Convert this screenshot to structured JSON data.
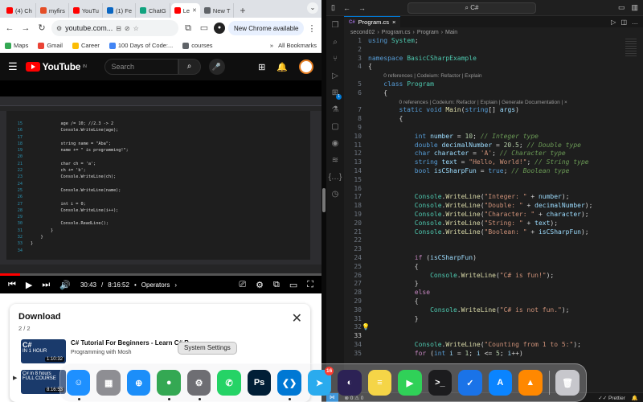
{
  "chrome": {
    "tabs": [
      {
        "label": "(4) Ch",
        "color": "#ff0000"
      },
      {
        "label": "myfirs",
        "color": "#e44d26"
      },
      {
        "label": "YouTu",
        "color": "#ff0000"
      },
      {
        "label": "(1) Fe",
        "color": "#0a66c2"
      },
      {
        "label": "ChatG",
        "color": "#10a37f"
      },
      {
        "label": "Le",
        "color": "#ff0000"
      },
      {
        "label": "New T",
        "color": "#5f6368"
      }
    ],
    "newtab_plus": "+",
    "url": "youtube.com...",
    "new_chrome_label": "New Chrome available",
    "profile_initial": "",
    "bookmarks": [
      {
        "label": "Maps",
        "color": "#34a853"
      },
      {
        "label": "Gmail",
        "color": "#ea4335"
      },
      {
        "label": "Career",
        "color": "#fbbc04"
      },
      {
        "label": "100 Days of Code:...",
        "color": "#4285f4"
      },
      {
        "label": "courses",
        "color": "#5f6368"
      }
    ],
    "all_bookmarks": "All Bookmarks",
    "more_bookmarks": "»"
  },
  "youtube": {
    "logo_text": "YouTube",
    "logo_region": "IN",
    "search_placeholder": "Search",
    "player": {
      "current_time": "30:43",
      "duration": "8:16:52",
      "time_separator": "/",
      "chapter": "Operators",
      "chapter_arrow": "›",
      "progress_fraction": 0.062
    },
    "vs_code_lines": [
      {
        "n": "15",
        "t": "            age /= 10; //2.3 -> 2"
      },
      {
        "n": "16",
        "t": "            Console.WriteLine(age);"
      },
      {
        "n": "17",
        "t": ""
      },
      {
        "n": "18",
        "t": "            string name = \"Aba\";"
      },
      {
        "n": "19",
        "t": "            name += \" is programming!\";"
      },
      {
        "n": "20",
        "t": ""
      },
      {
        "n": "21",
        "t": "            char ch = 'a';"
      },
      {
        "n": "22",
        "t": "            ch += 'b';"
      },
      {
        "n": "23",
        "t": "            Console.WriteLine(ch);"
      },
      {
        "n": "24",
        "t": ""
      },
      {
        "n": "25",
        "t": "            Console.WriteLine(name);"
      },
      {
        "n": "26",
        "t": ""
      },
      {
        "n": "27",
        "t": "            int i = 0;"
      },
      {
        "n": "28",
        "t": "            Console.WriteLine(i++);"
      },
      {
        "n": "29",
        "t": ""
      },
      {
        "n": "30",
        "t": "            Console.ReadLine();"
      },
      {
        "n": "31",
        "t": "        }"
      },
      {
        "n": "32",
        "t": "    }"
      },
      {
        "n": "33",
        "t": "}"
      },
      {
        "n": "34",
        "t": ""
      }
    ]
  },
  "download": {
    "title": "Download",
    "count": "2 / 2",
    "items": [
      {
        "title": "C# Tutorial For Beginners - Learn C# B",
        "channel": "Programming with Mosh",
        "duration": "1:10:32",
        "thumb_title": "C#",
        "thumb_sub": "IN 1 HOUR"
      },
      {
        "title": "",
        "channel": "",
        "duration": "8:16:53",
        "thumb_title": "C# in 8 hours",
        "thumb_sub": "FULL COURSE"
      }
    ]
  },
  "vscode": {
    "search_text": "C#",
    "tab_label": "Program.cs",
    "breadcrumb": [
      "second02",
      "Program.cs",
      "Program",
      "Main"
    ],
    "lines": [
      {
        "n": "1",
        "h": "<span class='kw'>using</span> <span class='ty'>System</span>;"
      },
      {
        "n": "2",
        "h": ""
      },
      {
        "n": "3",
        "h": "<span class='kw'>namespace</span> <span class='ty'>BasicCSharpExample</span>"
      },
      {
        "n": "4",
        "h": "{"
      },
      {
        "n": "",
        "h": "    <span class='lens'>0 references | Codeium: Refactor | Explain</span>"
      },
      {
        "n": "5",
        "h": "    <span class='kw'>class</span> <span class='ty'>Program</span>"
      },
      {
        "n": "6",
        "h": "    {"
      },
      {
        "n": "",
        "h": "        <span class='lens'>0 references | Codeium: Refactor | Explain | Generate Documentation | ×</span>"
      },
      {
        "n": "7",
        "h": "        <span class='kw'>static</span> <span class='kw'>void</span> <span class='fn'>Main</span>(<span class='kw'>string</span>[] <span class='vr'>args</span>)"
      },
      {
        "n": "8",
        "h": "        {"
      },
      {
        "n": "9",
        "h": ""
      },
      {
        "n": "10",
        "h": "            <span class='kw'>int</span> <span class='vr'>number</span> = <span class='nm'>10</span>; <span class='cm'>// Integer type</span>"
      },
      {
        "n": "11",
        "h": "            <span class='kw'>double</span> <span class='vr'>decimalNumber</span> = <span class='nm'>20.5</span>; <span class='cm'>// Double type</span>"
      },
      {
        "n": "12",
        "h": "            <span class='kw'>char</span> <span class='vr'>character</span> = <span class='st'>'A'</span>; <span class='cm'>// Character type</span>"
      },
      {
        "n": "13",
        "h": "            <span class='kw'>string</span> <span class='vr'>text</span> = <span class='st'>\"Hello, World!\"</span>; <span class='cm'>// String type</span>"
      },
      {
        "n": "14",
        "h": "            <span class='kw'>bool</span> <span class='vr'>isCSharpFun</span> = <span class='kw'>true</span>; <span class='cm'>// Boolean type</span>"
      },
      {
        "n": "15",
        "h": ""
      },
      {
        "n": "16",
        "h": ""
      },
      {
        "n": "17",
        "h": "            <span class='ty'>Console</span>.<span class='fn'>WriteLine</span>(<span class='st'>\"Integer: \"</span> + <span class='vr'>number</span>);"
      },
      {
        "n": "18",
        "h": "            <span class='ty'>Console</span>.<span class='fn'>WriteLine</span>(<span class='st'>\"Double: \"</span> + <span class='vr'>decimalNumber</span>);"
      },
      {
        "n": "19",
        "h": "            <span class='ty'>Console</span>.<span class='fn'>WriteLine</span>(<span class='st'>\"Character: \"</span> + <span class='vr'>character</span>);"
      },
      {
        "n": "20",
        "h": "            <span class='ty'>Console</span>.<span class='fn'>WriteLine</span>(<span class='st'>\"String: \"</span> + <span class='vr'>text</span>);"
      },
      {
        "n": "21",
        "h": "            <span class='ty'>Console</span>.<span class='fn'>WriteLine</span>(<span class='st'>\"Boolean: \"</span> + <span class='vr'>isCSharpFun</span>);"
      },
      {
        "n": "22",
        "h": ""
      },
      {
        "n": "23",
        "h": ""
      },
      {
        "n": "24",
        "h": "            <span class='kw2'>if</span> (<span class='vr'>isCSharpFun</span>)"
      },
      {
        "n": "25",
        "h": "            {"
      },
      {
        "n": "26",
        "h": "                <span class='ty'>Console</span>.<span class='fn'>WriteLine</span>(<span class='st'>\"C# is fun!\"</span>);"
      },
      {
        "n": "27",
        "h": "            }"
      },
      {
        "n": "28",
        "h": "            <span class='kw2'>else</span>"
      },
      {
        "n": "29",
        "h": "            {"
      },
      {
        "n": "30",
        "h": "                <span class='ty'>Console</span>.<span class='fn'>WriteLine</span>(<span class='st'>\"C# is not fun.\"</span>);"
      },
      {
        "n": "31",
        "h": "            }"
      },
      {
        "n": "32",
        "h": ""
      },
      {
        "n": "33",
        "h": ""
      },
      {
        "n": "34",
        "h": "            <span class='ty'>Console</span>.<span class='fn'>WriteLine</span>(<span class='st'>\"Counting from 1 to 5:\"</span>);"
      },
      {
        "n": "35",
        "h": "            <span class='kw2'>for</span> (<span class='kw'>int</span> <span class='vr'>i</span> = <span class='nm'>1</span>; <span class='vr'>i</span> &lt;= <span class='nm'>5</span>; <span class='vr'>i</span>++)"
      }
    ],
    "status_right": "Prettier"
  },
  "dock": {
    "tooltip": "System Settings",
    "telegram_badge": "16",
    "apps": [
      {
        "name": "finder-icon",
        "color": "#1e90ff",
        "glyph": "☺"
      },
      {
        "name": "launchpad-icon",
        "color": "#8e8e93",
        "glyph": "▦"
      },
      {
        "name": "safari-icon",
        "color": "#1c8ef9",
        "glyph": "⊕"
      },
      {
        "name": "chrome-icon",
        "color": "#34a853",
        "glyph": "●"
      },
      {
        "name": "system-settings-icon",
        "color": "#6e6e73",
        "glyph": "⚙"
      },
      {
        "name": "whatsapp-icon",
        "color": "#25d366",
        "glyph": "✆"
      },
      {
        "name": "photoshop-icon",
        "color": "#001e36",
        "glyph": "Ps"
      },
      {
        "name": "vscode-icon",
        "color": "#0078d4",
        "glyph": "❮❯"
      },
      {
        "name": "telegram-icon",
        "color": "#2aabee",
        "glyph": "➤"
      },
      {
        "name": "eclipse-icon",
        "color": "#2c2255",
        "glyph": "◐"
      },
      {
        "name": "notes-icon",
        "color": "#f5d547",
        "glyph": "≡"
      },
      {
        "name": "facetime-icon",
        "color": "#30d158",
        "glyph": "▶"
      },
      {
        "name": "terminal-icon",
        "color": "#1c1c1e",
        "glyph": ">_"
      },
      {
        "name": "todo-icon",
        "color": "#1a73e8",
        "glyph": "✓"
      },
      {
        "name": "app-store-icon",
        "color": "#0a84ff",
        "glyph": "A"
      },
      {
        "name": "vlc-icon",
        "color": "#ff8800",
        "glyph": "▲"
      },
      {
        "name": "trash-icon",
        "color": "#c7c7cc",
        "glyph": "🗑"
      }
    ]
  }
}
